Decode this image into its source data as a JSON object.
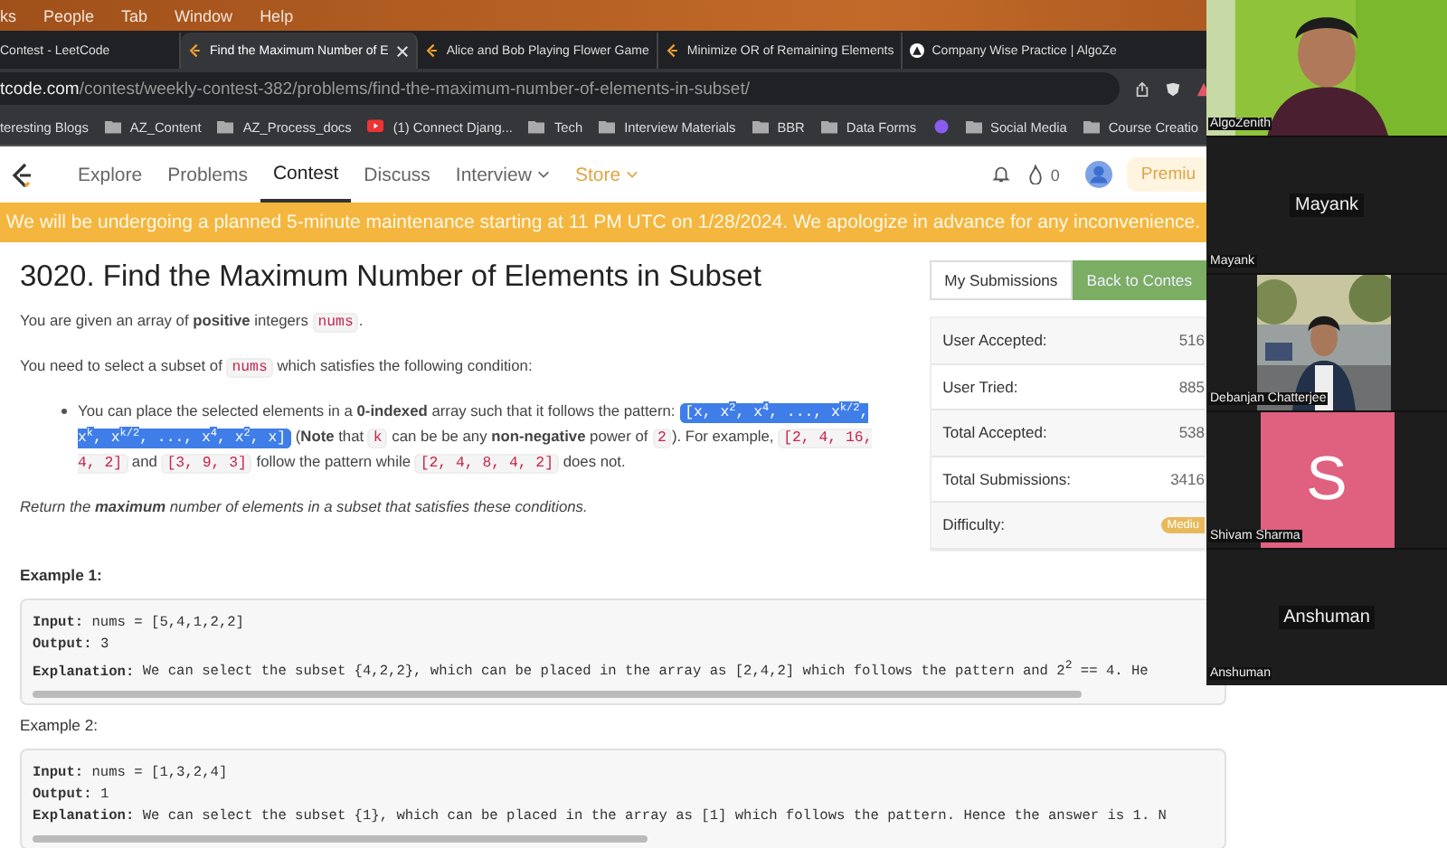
{
  "menu_bar": [
    "ks",
    "People",
    "Tab",
    "Window",
    "Help"
  ],
  "browser_tabs": [
    {
      "title": "Contest - LeetCode",
      "selected": false,
      "kind": "plain"
    },
    {
      "title": "Find the Maximum Number of E",
      "selected": true,
      "kind": "leetcode"
    },
    {
      "title": "Alice and Bob Playing Flower Game",
      "selected": false,
      "kind": "leetcode"
    },
    {
      "title": "Minimize OR of Remaining Elements",
      "selected": false,
      "kind": "leetcode"
    },
    {
      "title": "Company Wise Practice | AlgoZe",
      "selected": false,
      "kind": "algo"
    }
  ],
  "address": {
    "host": "tcode.com",
    "path": "/contest/weekly-contest-382/problems/find-the-maximum-number-of-elements-in-subset/"
  },
  "bookmarks": [
    {
      "label": "teresting Blogs",
      "kind": "link"
    },
    {
      "label": "AZ_Content",
      "kind": "folder"
    },
    {
      "label": "AZ_Process_docs",
      "kind": "folder"
    },
    {
      "label": "(1) Connect Djang...",
      "kind": "video"
    },
    {
      "label": "Tech",
      "kind": "folder"
    },
    {
      "label": "Interview Materials",
      "kind": "folder"
    },
    {
      "label": "BBR",
      "kind": "folder"
    },
    {
      "label": "Data Forms",
      "kind": "folder"
    },
    {
      "kind": "app"
    },
    {
      "label": "Social Media",
      "kind": "folder"
    },
    {
      "label": "Course Creatio",
      "kind": "folder"
    }
  ],
  "nav": {
    "items": [
      {
        "label": "Explore",
        "selected": false,
        "kind": "plain"
      },
      {
        "label": "Problems",
        "selected": false,
        "kind": "plain"
      },
      {
        "label": "Contest",
        "selected": true,
        "kind": "plain"
      },
      {
        "label": "Discuss",
        "selected": false,
        "kind": "plain"
      },
      {
        "label": "Interview",
        "selected": false,
        "kind": "dropdown"
      },
      {
        "label": "Store",
        "selected": false,
        "kind": "store"
      }
    ],
    "coins": "0",
    "premium": "Premiu"
  },
  "banner": "We will be undergoing a planned 5-minute maintenance starting at 11 PM UTC on 1/28/2024. We apologize in advance for any inconvenience.",
  "problem": {
    "title": "3020. Find the Maximum Number of Elements in Subset",
    "paragraphs": [
      [
        {
          "kind": "text",
          "text": "You are given an array of **positive** integers "
        },
        {
          "kind": "code",
          "text": "nums"
        },
        {
          "kind": "text",
          "text": "."
        }
      ],
      [
        {
          "kind": "text",
          "text": "You need to select a subset of "
        },
        {
          "kind": "code",
          "text": "nums"
        },
        {
          "kind": "text",
          "text": " which satisfies the following condition:"
        }
      ]
    ],
    "bullets": [
      [
        {
          "kind": "text",
          "text": "You can place the selected elements in a **0-indexed** array such that it follows the pattern: "
        },
        {
          "kind": "selected",
          "text": "[x, x$^{2}$, x$^{4}$, ..., x$^{k/2}$, x$^{k}$, x$^{k/2}$, ..., x$^{4}$, x$^{2}$, x]"
        },
        {
          "kind": "text",
          "text": " (**Note** that "
        },
        {
          "kind": "code",
          "text": "k"
        },
        {
          "kind": "text",
          "text": " can be be any **non-negative** power of "
        },
        {
          "kind": "code",
          "text": "2"
        },
        {
          "kind": "text",
          "text": "). For example, "
        },
        {
          "kind": "code",
          "text": "[2, 4, 16, 4, 2]"
        },
        {
          "kind": "text",
          "text": " and "
        },
        {
          "kind": "code",
          "text": "[3, 9, 3]"
        },
        {
          "kind": "text",
          "text": " follow the pattern while "
        },
        {
          "kind": "code",
          "text": "[2, 4, 8, 4, 2]"
        },
        {
          "kind": "text",
          "text": " does not."
        }
      ]
    ],
    "closing": "Return the **maximum** number of elements in a subset that satisfies these conditions.",
    "examples": [
      {
        "heading": "Example 1:",
        "lines": [
          {
            "key": "Input:",
            "text": " nums = [5,4,1,2,2]"
          },
          {
            "key": "Output:",
            "text": " 3"
          },
          {
            "key": "Explanation:",
            "text": " We can select the subset {4,2,2}, which can be placed in the array as [2,4,2] which follows the pattern and 2$^{2}$ == 4. He"
          }
        ]
      },
      {
        "heading": "Example 2:",
        "lines": [
          {
            "key": "Input:",
            "text": " nums = [1,3,2,4]"
          },
          {
            "key": "Output:",
            "text": " 1"
          },
          {
            "key": "Explanation:",
            "text": " We can select the subset {1}, which can be placed in the array as [1] which follows the pattern. Hence the answer is 1. N"
          }
        ]
      }
    ]
  },
  "side": {
    "buttons": [
      {
        "label": "My Submissions",
        "selected": false
      },
      {
        "label": "Back to Contes",
        "selected": true
      }
    ],
    "stats": [
      {
        "label": "User Accepted:",
        "value": "516"
      },
      {
        "label": "User Tried:",
        "value": "885"
      },
      {
        "label": "Total Accepted:",
        "value": "538"
      },
      {
        "label": "Total Submissions:",
        "value": "3416"
      }
    ],
    "difficulty": {
      "label": "Difficulty:",
      "value": "Mediu"
    }
  },
  "call": [
    {
      "name": "AlgoZenith",
      "kind": "video"
    },
    {
      "name": "Mayank",
      "kind": "label",
      "center": "Mayank"
    },
    {
      "name": "Debanjan Chatterjee"
    },
    {
      "name": "Shivam Sharma",
      "kind": "letter",
      "center": "S"
    },
    {
      "name": "Anshuman",
      "kind": "label",
      "center": "Anshuman"
    }
  ]
}
